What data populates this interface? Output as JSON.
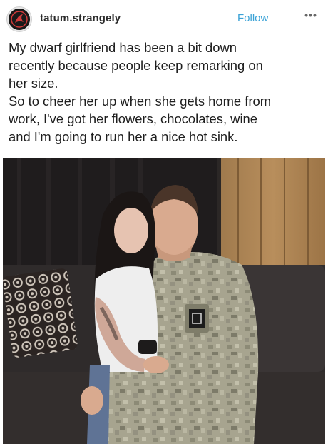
{
  "header": {
    "username": "tatum.strangely",
    "follow_label": "Follow",
    "more_label": "•••",
    "avatar_icon": "profile-logo-icon"
  },
  "caption": {
    "lines": [
      "My dwarf girlfriend has been a bit down",
      "recently because people keep remarking on",
      "her size.",
      "So to cheer her up when she gets home from",
      "work, I've got her flowers, chocolates, wine",
      "and I'm going to run her a nice hot sink."
    ]
  },
  "colors": {
    "follow": "#3aa2d6",
    "text": "#1e1e1e"
  }
}
